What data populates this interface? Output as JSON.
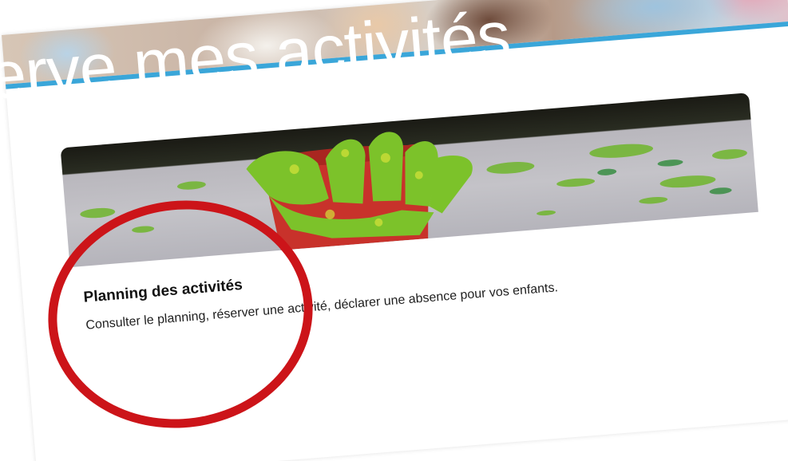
{
  "header": {
    "title": "erve mes activités"
  },
  "card": {
    "title": "Planning des activités",
    "description": "Consulter le planning, réserver une activité, déclarer une absence pour vos enfants."
  },
  "colors": {
    "accent_stripe": "#3aa6d9",
    "highlight": "#cc1419",
    "paint_green": "#7cc22a",
    "pot_red": "#c8322b"
  },
  "icons": {
    "annotation": "red-circle-annotation"
  }
}
